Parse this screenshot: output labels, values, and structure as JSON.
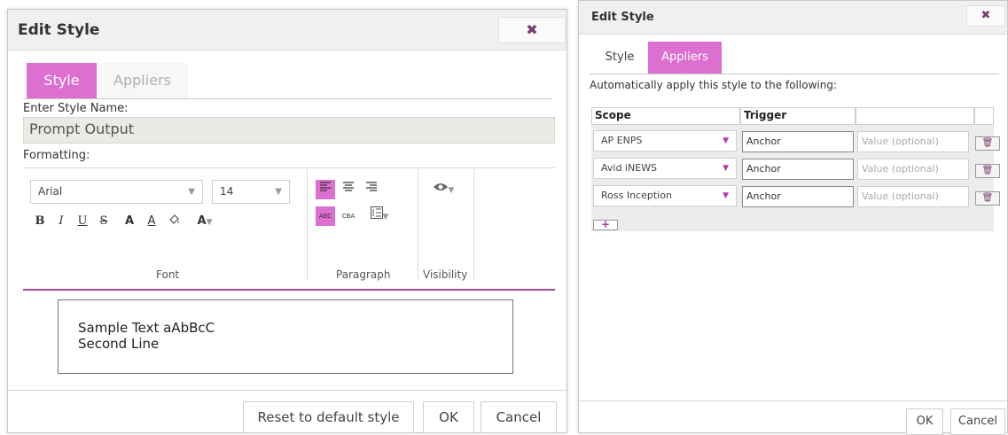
{
  "left_dialog": {
    "title": "Edit Style",
    "close_glyph": "✖",
    "tabs": [
      {
        "label": "Style",
        "active": true
      },
      {
        "label": "Appliers",
        "active": false
      }
    ],
    "name_label": "Enter Style Name:",
    "name_value": "Prompt Output",
    "formatting_label": "Formatting:",
    "font": {
      "family": "Arial",
      "size": "14",
      "buttons": [
        "B",
        "I",
        "U",
        "S",
        "A",
        "A",
        "⛀",
        "A"
      ],
      "group_label": "Font"
    },
    "paragraph": {
      "group_label": "Paragraph",
      "align_buttons": [
        "align-left",
        "align-center",
        "align-right"
      ],
      "direction_buttons": [
        "ltr",
        "rtl",
        "line-spacing"
      ],
      "ltr_text": "ABC",
      "rtl_text": "CBA"
    },
    "visibility": {
      "group_label": "Visibility"
    },
    "preview_lines": [
      "Sample Text aAbBcC",
      "Second Line"
    ],
    "buttons": {
      "reset": "Reset to default style",
      "ok": "OK",
      "cancel": "Cancel"
    }
  },
  "right_dialog": {
    "title": "Edit Style",
    "close_glyph": "✖",
    "tabs": [
      {
        "label": "Style",
        "active": false
      },
      {
        "label": "Appliers",
        "active": true
      }
    ],
    "description": "Automatically apply this style to the following:",
    "columns": [
      "Scope",
      "Trigger"
    ],
    "rows": [
      {
        "scope": "AP ENPS",
        "trigger": "Anchor",
        "value_placeholder": "Value (optional)"
      },
      {
        "scope": "Avid iNEWS",
        "trigger": "Anchor",
        "value_placeholder": "Value (optional)"
      },
      {
        "scope": "Ross Inception",
        "trigger": "Anchor",
        "value_placeholder": "Value (optional)"
      }
    ],
    "buttons": {
      "ok": "OK",
      "cancel": "Cancel"
    }
  },
  "colors": {
    "accent": "#dd6fd0",
    "close": "#7a3d6f",
    "divider": "#a04a96"
  }
}
